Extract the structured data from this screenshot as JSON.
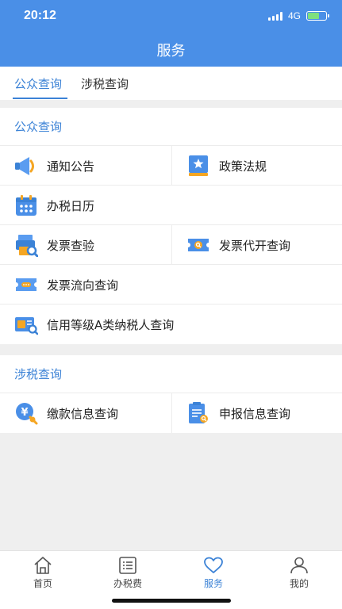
{
  "status_bar": {
    "time": "20:12",
    "network": "4G",
    "battery_icon": "battery-charging-icon"
  },
  "nav": {
    "title": "服务"
  },
  "tabs": [
    {
      "label": "公众查询",
      "active": true
    },
    {
      "label": "涉税查询",
      "active": false
    }
  ],
  "sections": {
    "public": {
      "title": "公众查询",
      "items": [
        {
          "label": "通知公告",
          "icon": "megaphone-icon"
        },
        {
          "label": "政策法规",
          "icon": "policy-book-icon"
        },
        {
          "label": "办税日历",
          "icon": "calendar-icon"
        },
        {
          "label": "发票查验",
          "icon": "invoice-check-icon"
        },
        {
          "label": "发票代开查询",
          "icon": "invoice-ticket-icon"
        },
        {
          "label": "发票流向查询",
          "icon": "invoice-flow-icon"
        },
        {
          "label": "信用等级A类纳税人查询",
          "icon": "credit-search-icon"
        }
      ]
    },
    "tax": {
      "title": "涉税查询",
      "items": [
        {
          "label": "缴款信息查询",
          "icon": "payment-search-icon"
        },
        {
          "label": "申报信息查询",
          "icon": "declaration-search-icon"
        }
      ]
    }
  },
  "tabbar": [
    {
      "label": "首页",
      "icon": "home-icon",
      "active": false
    },
    {
      "label": "办税费",
      "icon": "list-icon",
      "active": false
    },
    {
      "label": "服务",
      "icon": "heart-icon",
      "active": true
    },
    {
      "label": "我的",
      "icon": "user-icon",
      "active": false
    }
  ],
  "colors": {
    "primary": "#4a8fe7",
    "accent_text": "#3b82d6",
    "icon_orange": "#f5a623",
    "background": "#efefef"
  }
}
